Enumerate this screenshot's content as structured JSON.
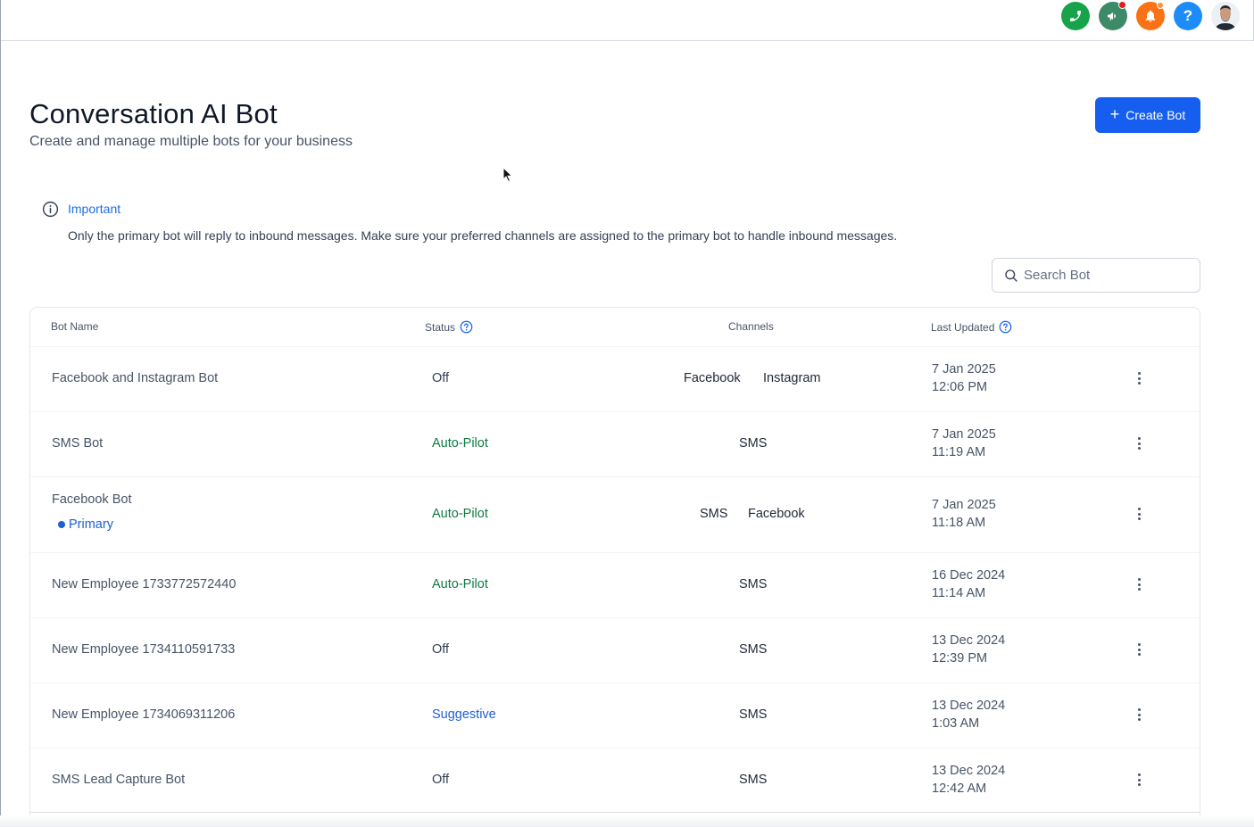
{
  "header": {
    "title": "Conversation AI Bot",
    "subtitle": "Create and manage multiple bots for your business",
    "create_label": "Create Bot"
  },
  "notice": {
    "title": "Important",
    "text": "Only the primary bot will reply to inbound messages. Make sure your preferred channels are assigned to the primary bot to handle inbound messages."
  },
  "search": {
    "placeholder": "Search Bot"
  },
  "table": {
    "columns": {
      "name": "Bot Name",
      "status": "Status",
      "channels": "Channels",
      "updated": "Last Updated"
    },
    "rows": [
      {
        "name": "Facebook and Instagram Bot",
        "status": "Off",
        "channels": [
          "Facebook",
          "Instagram"
        ],
        "date": "7 Jan 2025",
        "time": "12:06 PM"
      },
      {
        "name": "SMS Bot",
        "status": "Auto-Pilot",
        "channels": [
          "SMS"
        ],
        "date": "7 Jan 2025",
        "time": "11:19 AM"
      },
      {
        "name": "Facebook Bot",
        "badge": "Primary",
        "status": "Auto-Pilot",
        "channels": [
          "SMS",
          "Facebook"
        ],
        "date": "7 Jan 2025",
        "time": "11:18 AM"
      },
      {
        "name": "New Employee 1733772572440",
        "status": "Auto-Pilot",
        "channels": [
          "SMS"
        ],
        "date": "16 Dec 2024",
        "time": "11:14 AM"
      },
      {
        "name": "New Employee 1734110591733",
        "status": "Off",
        "channels": [
          "SMS"
        ],
        "date": "13 Dec 2024",
        "time": "12:39 PM"
      },
      {
        "name": "New Employee 1734069311206",
        "status": "Suggestive",
        "channels": [
          "SMS"
        ],
        "date": "13 Dec 2024",
        "time": "1:03 AM"
      },
      {
        "name": "SMS Lead Capture Bot",
        "status": "Off",
        "channels": [
          "SMS"
        ],
        "date": "13 Dec 2024",
        "time": "12:42 AM"
      }
    ]
  },
  "topbar": {
    "help_label": "?",
    "icons": [
      "phone-icon",
      "megaphone-icon",
      "bell-icon",
      "help-icon",
      "avatar"
    ],
    "colors": {
      "phone": "#16a34a",
      "megaphone": "#3d8a68",
      "bell": "#f97316",
      "help": "#1d8cf8"
    }
  },
  "colors": {
    "accent": "#155eef",
    "status_autopilot": "#0f7a43",
    "status_suggestive": "#1d5fd6",
    "status_off": "#344054"
  }
}
